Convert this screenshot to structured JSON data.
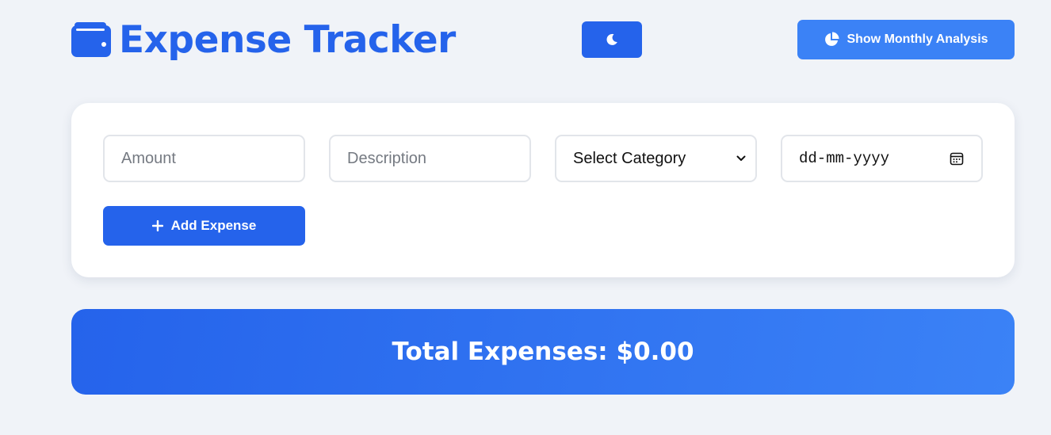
{
  "header": {
    "title": "Expense Tracker",
    "title_icon": "wallet-icon",
    "theme_toggle_icon": "moon-icon",
    "analysis_button_icon": "pie-chart-icon",
    "analysis_button_label": "Show Monthly Analysis"
  },
  "form": {
    "amount": {
      "placeholder": "Amount",
      "value": ""
    },
    "description": {
      "placeholder": "Description",
      "value": ""
    },
    "category": {
      "selected": "Select Category",
      "icon": "chevron-down-icon"
    },
    "date": {
      "placeholder": "dd-mm-yyyy",
      "icon": "calendar-icon"
    },
    "add_button_icon": "plus-icon",
    "add_button_label": "Add Expense"
  },
  "summary": {
    "total_label": "Total Expenses: $0.00"
  },
  "colors": {
    "primary": "#2563eb",
    "primary_light": "#3b82f6",
    "background": "#f0f3f8",
    "card": "#ffffff",
    "input_border": "#e2e5ea",
    "placeholder_text": "#757a82"
  }
}
